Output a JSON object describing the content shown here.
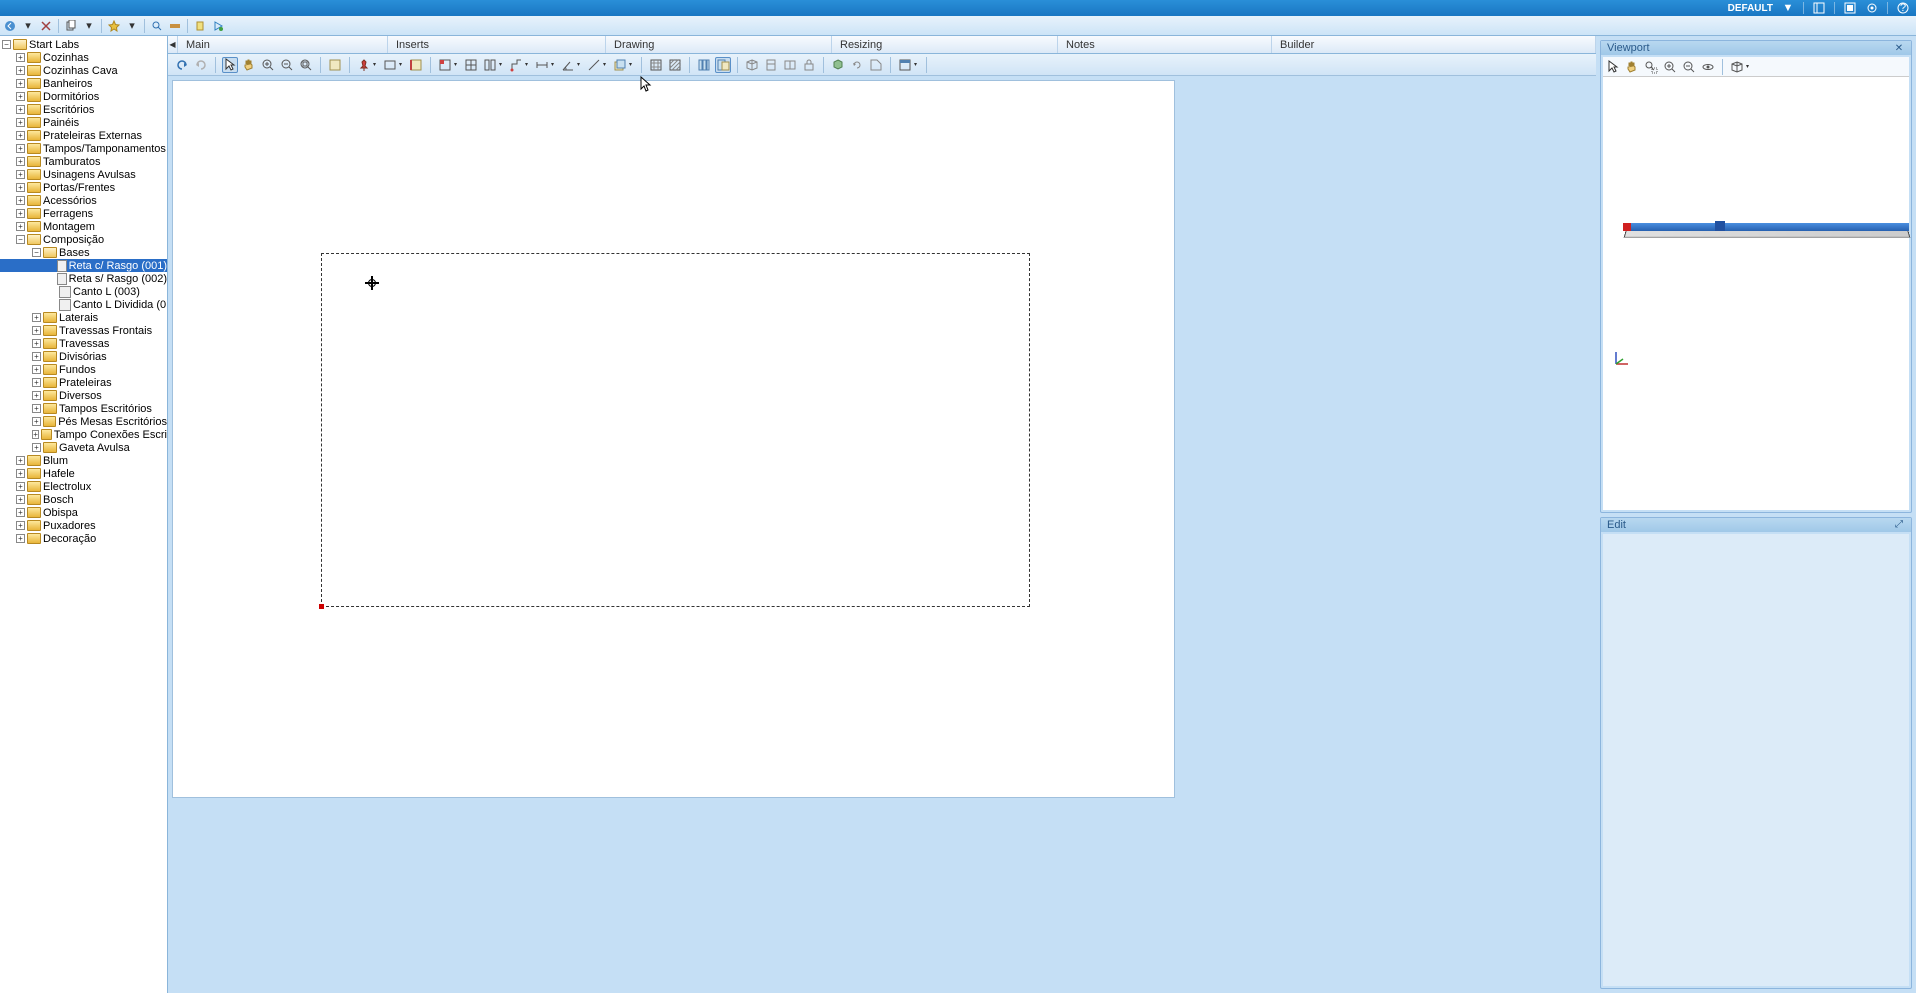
{
  "titlebar": {
    "default_label": "DEFAULT",
    "down_arrow": "▼"
  },
  "tabs": {
    "main": "Main",
    "inserts": "Inserts",
    "drawing": "Drawing",
    "resizing": "Resizing",
    "notes": "Notes",
    "builder": "Builder"
  },
  "tree": {
    "root": "Start Labs",
    "items_l1": [
      {
        "label": "Cozinhas",
        "exp": "+"
      },
      {
        "label": "Cozinhas Cava",
        "exp": "+"
      },
      {
        "label": "Banheiros",
        "exp": "+"
      },
      {
        "label": "Dormitórios",
        "exp": "+"
      },
      {
        "label": "Escritórios",
        "exp": "+"
      },
      {
        "label": "Painéis",
        "exp": "+"
      },
      {
        "label": "Prateleiras Externas",
        "exp": "+"
      },
      {
        "label": "Tampos/Tamponamentos",
        "exp": "+"
      },
      {
        "label": "Tamburatos",
        "exp": "+"
      },
      {
        "label": "Usinagens Avulsas",
        "exp": "+"
      },
      {
        "label": "Portas/Frentes",
        "exp": "+"
      },
      {
        "label": "Acessórios",
        "exp": "+"
      },
      {
        "label": "Ferragens",
        "exp": "+"
      },
      {
        "label": "Montagem",
        "exp": "+"
      }
    ],
    "composicao": {
      "label": "Composição",
      "exp": "−"
    },
    "bases": {
      "label": "Bases",
      "exp": "−"
    },
    "base_items": [
      {
        "label": "Reta c/ Rasgo (001)",
        "selected": true
      },
      {
        "label": "Reta s/ Rasgo (002)",
        "selected": false
      },
      {
        "label": "Canto L (003)",
        "selected": false
      },
      {
        "label": "Canto L Dividida (0",
        "selected": false
      }
    ],
    "comp_items": [
      {
        "label": "Laterais",
        "exp": "+"
      },
      {
        "label": "Travessas Frontais",
        "exp": "+"
      },
      {
        "label": "Travessas",
        "exp": "+"
      },
      {
        "label": "Divisórias",
        "exp": "+"
      },
      {
        "label": "Fundos",
        "exp": "+"
      },
      {
        "label": "Prateleiras",
        "exp": "+"
      },
      {
        "label": "Diversos",
        "exp": "+"
      },
      {
        "label": "Tampos Escritórios",
        "exp": "+"
      },
      {
        "label": "Pés Mesas Escritórios",
        "exp": "+"
      },
      {
        "label": "Tampo Conexões Escri",
        "exp": "+"
      },
      {
        "label": "Gaveta Avulsa",
        "exp": "+"
      }
    ],
    "items_l1b": [
      {
        "label": "Blum",
        "exp": "+"
      },
      {
        "label": "Hafele",
        "exp": "+"
      },
      {
        "label": "Electrolux",
        "exp": "+"
      },
      {
        "label": "Bosch",
        "exp": "+"
      },
      {
        "label": "Obispa",
        "exp": "+"
      },
      {
        "label": "Puxadores",
        "exp": "+"
      },
      {
        "label": "Decoração",
        "exp": "+"
      }
    ]
  },
  "panels": {
    "viewport_title": "Viewport",
    "edit_title": "Edit"
  }
}
